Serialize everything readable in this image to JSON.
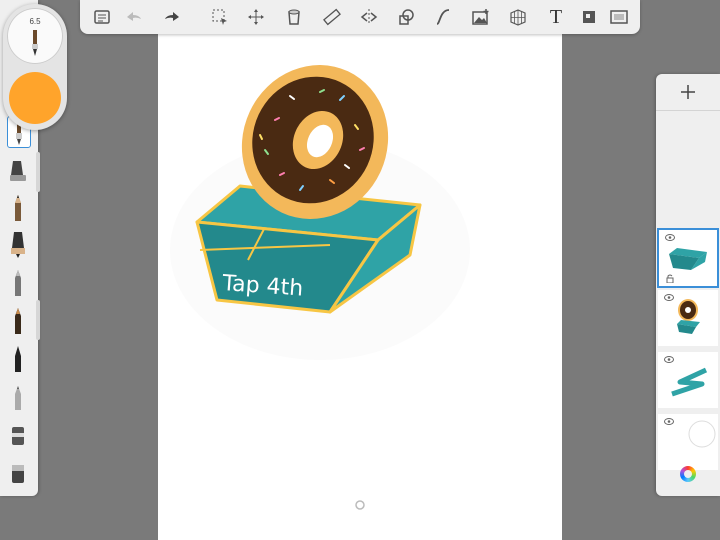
{
  "toolbar": {
    "tools": [
      {
        "icon": "list-icon"
      },
      {
        "icon": "undo-icon"
      },
      {
        "icon": "redo-icon"
      },
      {
        "icon": "select-icon"
      },
      {
        "icon": "move-icon"
      },
      {
        "icon": "fill-icon"
      },
      {
        "icon": "ruler-icon"
      },
      {
        "icon": "symmetry-icon"
      },
      {
        "icon": "shapes-icon"
      },
      {
        "icon": "curve-icon"
      },
      {
        "icon": "image-icon"
      },
      {
        "icon": "perspective-icon"
      },
      {
        "icon": "text-icon",
        "glyph": "T"
      },
      {
        "icon": "layers-icon"
      },
      {
        "icon": "fullscreen-icon"
      }
    ]
  },
  "brush_puck": {
    "size": "6.5",
    "color": "#ffa42b"
  },
  "brushes": [
    "pen",
    "airbrush",
    "pencil",
    "ink-pen",
    "marker",
    "felt-pen",
    "brush-pen",
    "fine-liner",
    "smudge",
    "eraser"
  ],
  "drawing": {
    "box_label": "Tap 4th",
    "box_color": "#2fa3a6",
    "box_outline": "#f7c644",
    "donut_color": "#f3b85a",
    "chocolate_color": "#4a2a12"
  },
  "layers": [
    {
      "name": "box",
      "selected": true,
      "locked": true
    },
    {
      "name": "donut-box",
      "selected": false
    },
    {
      "name": "zigzag",
      "selected": false
    },
    {
      "name": "background",
      "selected": false
    }
  ],
  "colors": {
    "accent": "#3b8fd8",
    "panel": "#efefef"
  }
}
